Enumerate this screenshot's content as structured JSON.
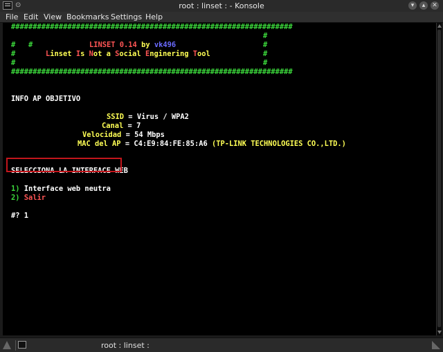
{
  "window": {
    "title": "root : linset : - Konsole",
    "buttons": [
      "▾",
      "▴",
      "✕"
    ]
  },
  "menu": [
    "File",
    "Edit",
    "View",
    "Bookmarks",
    "Settings",
    "Help"
  ],
  "terminal": {
    "border_line": "#################################################################",
    "hash": "#",
    "title_name": "LINSET 0.14",
    "title_by": "by",
    "title_author": "vk496",
    "tagline_parts": [
      "L",
      "inset ",
      "I",
      "s ",
      "N",
      "ot a ",
      "S",
      "ocial ",
      "E",
      "nginering ",
      "T",
      "ool"
    ],
    "info_heading": "INFO AP OBJETIVO",
    "ssid_label": "SSID",
    "ssid_value": "Virus / WPA2",
    "canal_label": "Canal",
    "canal_value": "7",
    "velocidad_label": "Velocidad",
    "velocidad_value": "54 Mbps",
    "mac_label": "MAC del AP",
    "mac_value": "C4:E9:84:FE:85:A6",
    "mac_vendor": "(TP-LINK TECHNOLOGIES CO.,LTD.)",
    "eq": "=",
    "select_heading": "SELECCIONA LA INTERFACE WEB",
    "option1_num": "1)",
    "option1_label": "Interface web neutra",
    "option2_num": "2)",
    "option2_label": "Salir",
    "prompt": "#?",
    "input": "1"
  },
  "statusbar": {
    "tab_label": "root : linset :"
  },
  "colors": {
    "green": "#3cd93c",
    "red": "#ff5555",
    "blue": "#6b6bff",
    "yellow": "#ffff55",
    "highlight": "#c3161c"
  }
}
